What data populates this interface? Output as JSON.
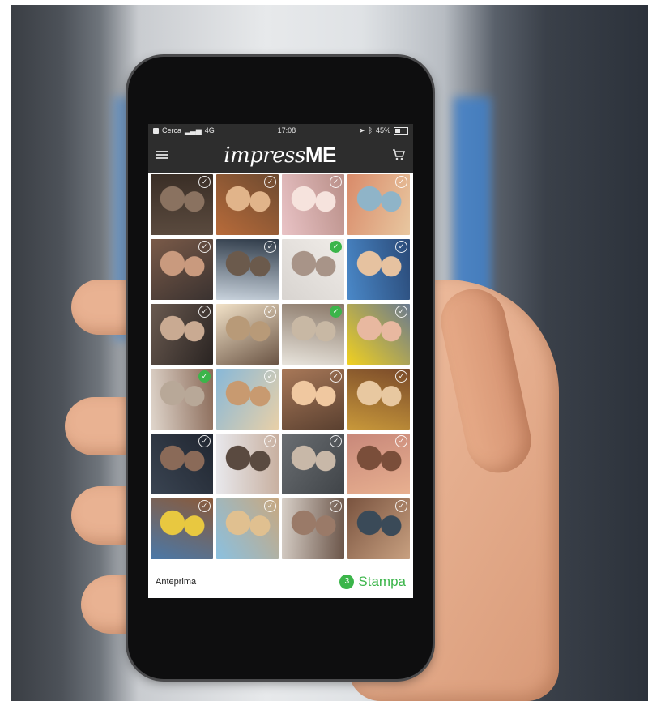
{
  "statusbar": {
    "back_label": "Cerca",
    "network": "4G",
    "time": "17:08",
    "battery": "45%"
  },
  "appbar": {
    "logo_script": "impress",
    "logo_bold": "ME",
    "menu_icon": "hamburger-menu-icon",
    "cart_icon": "shopping-cart-icon"
  },
  "photos": [
    {
      "selected": false,
      "colors": [
        "#5a4a3e",
        "#8a7260",
        "#3a2e26"
      ]
    },
    {
      "selected": false,
      "colors": [
        "#b86b3a",
        "#e1b48a",
        "#6d4a30"
      ]
    },
    {
      "selected": false,
      "colors": [
        "#e9c3c6",
        "#f6e3dd",
        "#b98f88"
      ]
    },
    {
      "selected": false,
      "colors": [
        "#d98b6a",
        "#8fb4c8",
        "#e8c7a0"
      ]
    },
    {
      "selected": false,
      "colors": [
        "#7a5a48",
        "#c99a7e",
        "#3a3230"
      ]
    },
    {
      "selected": false,
      "colors": [
        "#c8d2dc",
        "#6b5a4c",
        "#2e3a48"
      ]
    },
    {
      "selected": true,
      "colors": [
        "#d8d4d0",
        "#a89488",
        "#f0ece8"
      ]
    },
    {
      "selected": false,
      "colors": [
        "#4a88c8",
        "#e6c2a0",
        "#2a4a78"
      ]
    },
    {
      "selected": false,
      "colors": [
        "#6a5a50",
        "#c9aa92",
        "#2a2422"
      ]
    },
    {
      "selected": false,
      "colors": [
        "#f2e2c8",
        "#b89a78",
        "#6a5444"
      ]
    },
    {
      "selected": true,
      "colors": [
        "#e8e4dc",
        "#c8b8a4",
        "#8a7868"
      ]
    },
    {
      "selected": false,
      "colors": [
        "#f0d020",
        "#e8b8a0",
        "#6a7a90"
      ]
    },
    {
      "selected": true,
      "colors": [
        "#e0d6cc",
        "#b8a898",
        "#8a6a58"
      ]
    },
    {
      "selected": false,
      "colors": [
        "#88b8d8",
        "#c89a70",
        "#e8d0a8"
      ]
    },
    {
      "selected": false,
      "colors": [
        "#a87858",
        "#f0c8a0",
        "#5a4030"
      ]
    },
    {
      "selected": false,
      "colors": [
        "#c8983a",
        "#e8c8a0",
        "#7a4a2a"
      ]
    },
    {
      "selected": false,
      "colors": [
        "#3a4452",
        "#8a6a58",
        "#202630"
      ]
    },
    {
      "selected": false,
      "colors": [
        "#e8e8ec",
        "#5a4a40",
        "#c8b0a0"
      ]
    },
    {
      "selected": false,
      "colors": [
        "#6a6e72",
        "#c8b8a8",
        "#404448"
      ]
    },
    {
      "selected": false,
      "colors": [
        "#c8887a",
        "#7a4e3a",
        "#e8b090"
      ]
    },
    {
      "selected": false,
      "colors": [
        "#4a78a8",
        "#e8c840",
        "#8a5a3a"
      ]
    },
    {
      "selected": false,
      "colors": [
        "#8ac0e0",
        "#e0c090",
        "#c8a880"
      ]
    },
    {
      "selected": false,
      "colors": [
        "#d8d0c8",
        "#9a7a68",
        "#6a5448"
      ]
    },
    {
      "selected": false,
      "colors": [
        "#7a5440",
        "#3a4a58",
        "#c8a080"
      ]
    }
  ],
  "footer": {
    "preview_label": "Anteprima",
    "selected_count": "3",
    "print_label": "Stampa"
  },
  "colors": {
    "bar": "#2d2d2d",
    "accent_green": "#3bb54a"
  }
}
